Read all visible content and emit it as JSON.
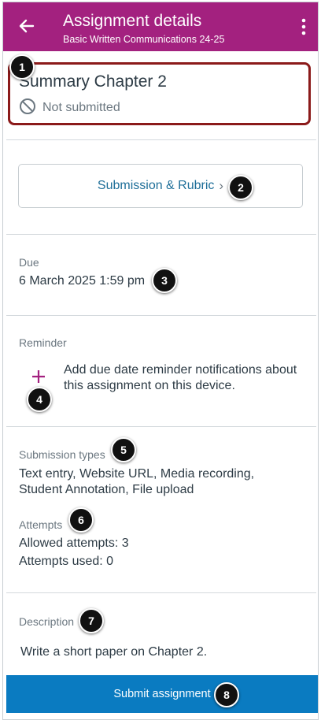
{
  "header": {
    "title": "Assignment details",
    "subtitle": "Basic Written Communications 24-25",
    "back_icon": "arrow-left-icon",
    "more_icon": "vertical-dots-icon",
    "bar_color": "#a3217f"
  },
  "assignment": {
    "title": "Summary Chapter 2",
    "status": "Not submitted",
    "status_icon": "not-submitted-icon"
  },
  "submission_button": {
    "label": "Submission & Rubric",
    "chevron": "›"
  },
  "due": {
    "label": "Due",
    "value": "6 March 2025 1:59 pm"
  },
  "reminder": {
    "label": "Reminder",
    "text": "Add due date reminder notifications about this assignment on this device."
  },
  "submission_types": {
    "label": "Submission types",
    "line1": "Text entry, Website URL, Media recording,",
    "line2": "Student Annotation, File upload"
  },
  "attempts": {
    "label": "Attempts",
    "allowed": "Allowed attempts: 3",
    "used": "Attempts used: 0"
  },
  "description": {
    "label": "Description",
    "text": "Write a short paper on Chapter 2."
  },
  "submit": {
    "label": "Submit assignment",
    "color": "#0a7bc1"
  },
  "callouts": [
    "1",
    "2",
    "3",
    "4",
    "5",
    "6",
    "7",
    "8"
  ]
}
